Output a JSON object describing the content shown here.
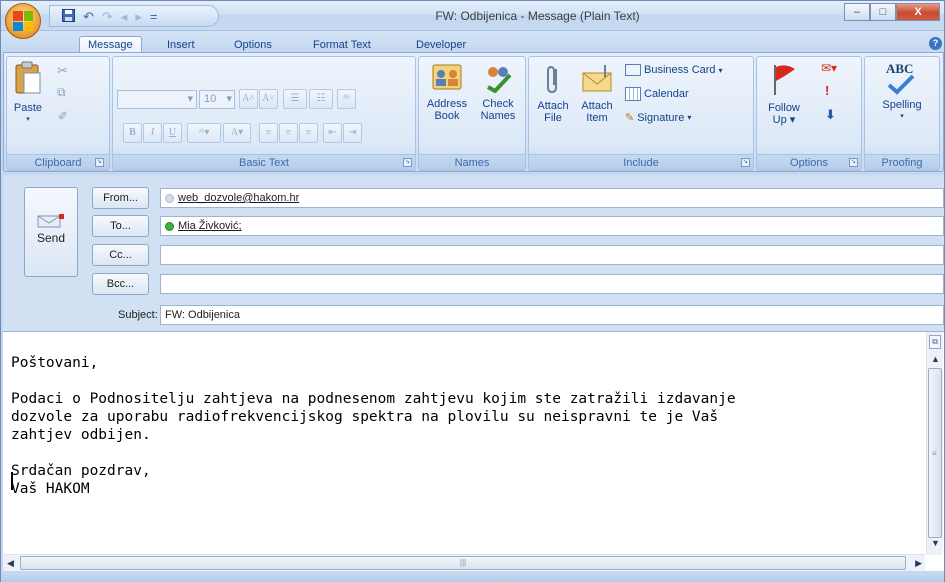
{
  "window": {
    "title": "FW: Odbijenica - Message (Plain Text)",
    "controls": {
      "minimize": "–",
      "maximize": "□",
      "close": "X"
    }
  },
  "quick_access": {
    "save_icon": "save-icon",
    "undo_icon": "undo-icon",
    "redo_icon": "redo-icon",
    "customize": "="
  },
  "tabs": [
    {
      "label": "Message",
      "active": true
    },
    {
      "label": "Insert"
    },
    {
      "label": "Options"
    },
    {
      "label": "Format Text"
    },
    {
      "label": "Developer"
    }
  ],
  "ribbon": {
    "clipboard": {
      "label": "Clipboard",
      "paste": "Paste"
    },
    "basic_text": {
      "label": "Basic Text",
      "font_name": "",
      "font_size": "10",
      "bold": "B",
      "italic": "I",
      "underline": "U"
    },
    "names": {
      "label": "Names",
      "address_book_1": "Address",
      "address_book_2": "Book",
      "check_names_1": "Check",
      "check_names_2": "Names"
    },
    "include": {
      "label": "Include",
      "attach_file_1": "Attach",
      "attach_file_2": "File",
      "attach_item_1": "Attach",
      "attach_item_2": "Item",
      "business_card": "Business Card",
      "calendar": "Calendar",
      "signature": "Signature"
    },
    "options": {
      "label": "Options",
      "follow_up_1": "Follow",
      "follow_up_2": "Up"
    },
    "proofing": {
      "label": "Proofing",
      "spelling": "Spelling",
      "abc": "ABC"
    }
  },
  "header": {
    "send": "Send",
    "from_button": "From...",
    "from_value": "web_dozvole@hakom.hr",
    "to_button": "To...",
    "to_value": "Mia Živković;",
    "cc_button": "Cc...",
    "cc_value": "",
    "bcc_button": "Bcc...",
    "bcc_value": "",
    "subject_label": "Subject:",
    "subject_value": "FW: Odbijenica"
  },
  "body": {
    "text": "Poštovani,\n\nPodaci o Podnositelju zahtjeva na podnesenom zahtjevu kojim ste zatražili izdavanje\ndozvole za uporabu radiofrekvencijskog spektra na plovilu su neispravni te je Vaš\nzahtjev odbijen.\n\nSrdačan pozdrav,\nVaš HAKOM"
  },
  "colors": {
    "accent": "#15428b",
    "ribbon_bg": "#dde9f7",
    "presence_green": "#3cb23c"
  }
}
